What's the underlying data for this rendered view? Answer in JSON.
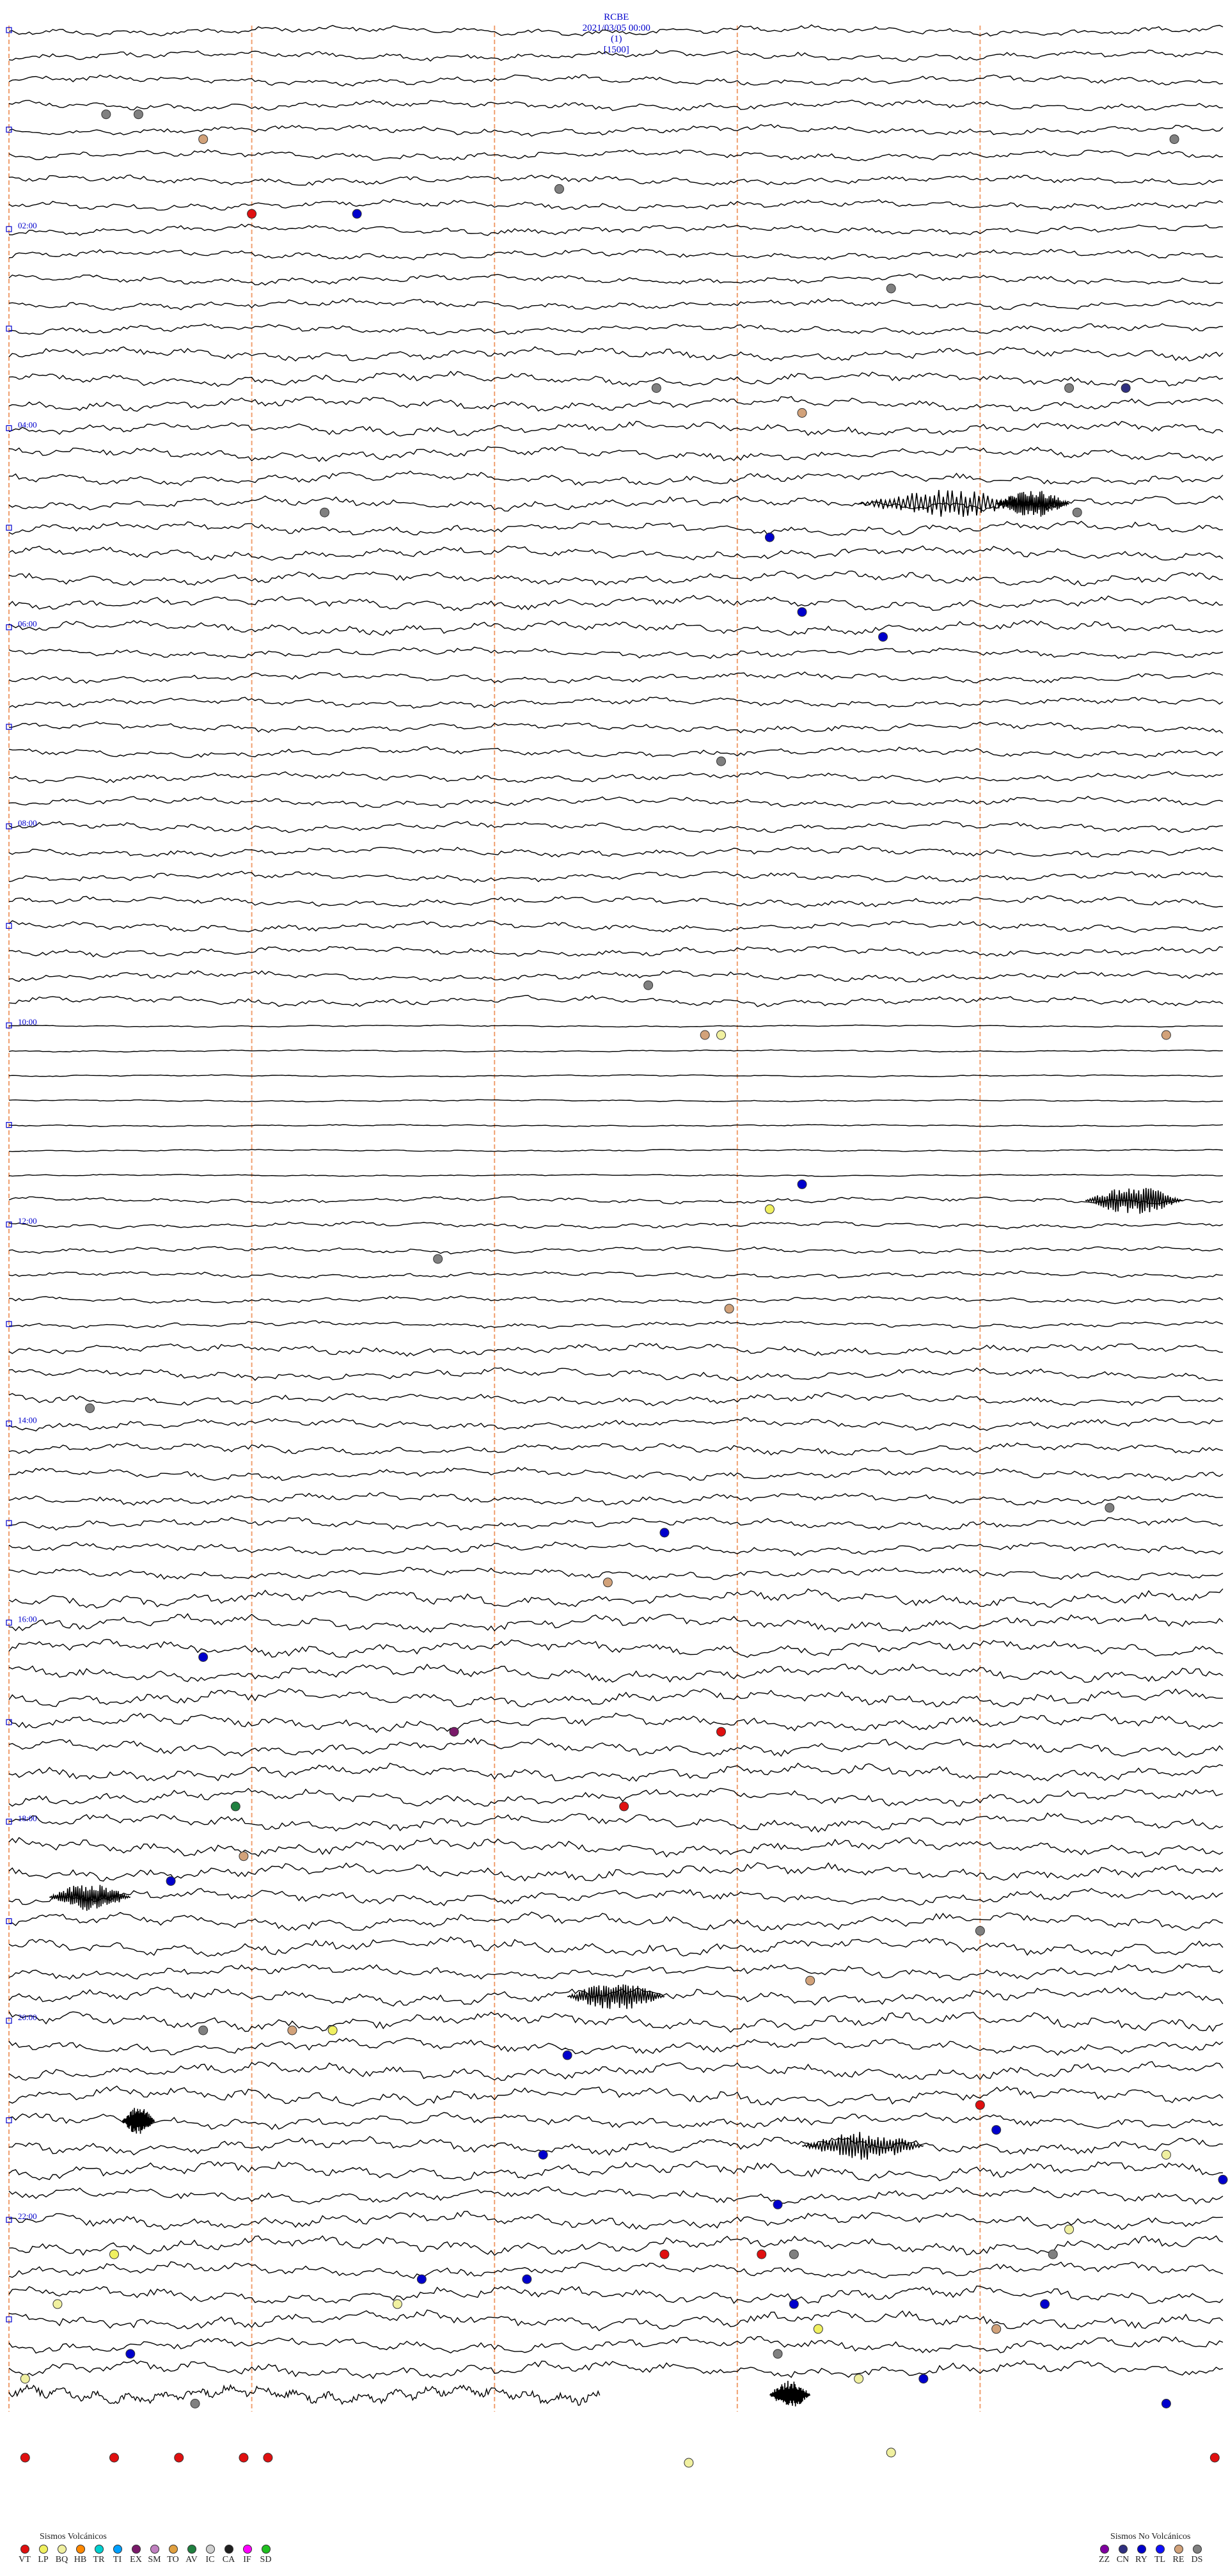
{
  "header": {
    "station": "RCBE",
    "datetime": "2021/03/05 00:00",
    "channel": "(1)",
    "scale": "[1500]"
  },
  "chart_data": {
    "type": "line",
    "description_kind": "helicorder",
    "trace_count": 96,
    "minutes_per_trace": 15,
    "hour_labels": [
      "02:00",
      "04:00",
      "06:00",
      "08:00",
      "10:00",
      "12:00",
      "14:00",
      "16:00",
      "18:00",
      "20:00",
      "22:00"
    ],
    "grid_x_minutes": [
      0,
      3,
      6,
      9,
      12
    ],
    "colors": {
      "trace": "#000000",
      "grid": "#f0a070",
      "labels": "#0000cc",
      "VT": "#e01010",
      "LP": "#f0f060",
      "BQ": "#f0f0a0",
      "HB": "#ff8800",
      "TR": "#00d0d0",
      "TI": "#00a0ff",
      "EX": "#7a1a6a",
      "SM": "#c080c0",
      "TO": "#e0a040",
      "AV": "#208040",
      "IC": "#d0d0d0",
      "CA": "#202020",
      "IF": "#ff00ff",
      "SD": "#20c020",
      "ZZ": "#8000a0",
      "CN": "#303080",
      "RY": "#0000cc",
      "TL": "#1010ff",
      "RE": "#d2a27a",
      "DS": "#808080"
    },
    "events": [
      {
        "trace": 3,
        "minute": 1.2,
        "type": "DS"
      },
      {
        "trace": 3,
        "minute": 1.6,
        "type": "DS"
      },
      {
        "trace": 4,
        "minute": 2.4,
        "type": "RE"
      },
      {
        "trace": 4,
        "minute": 14.4,
        "type": "DS"
      },
      {
        "trace": 6,
        "minute": 6.8,
        "type": "DS"
      },
      {
        "trace": 7,
        "minute": 3.0,
        "type": "VT"
      },
      {
        "trace": 7,
        "minute": 4.3,
        "type": "RY"
      },
      {
        "trace": 10,
        "minute": 10.9,
        "type": "DS"
      },
      {
        "trace": 14,
        "minute": 8.0,
        "type": "DS"
      },
      {
        "trace": 14,
        "minute": 13.1,
        "type": "DS"
      },
      {
        "trace": 14,
        "minute": 13.8,
        "type": "CN"
      },
      {
        "trace": 15,
        "minute": 9.8,
        "type": "RE"
      },
      {
        "trace": 19,
        "minute": 13.2,
        "type": "DS"
      },
      {
        "trace": 19,
        "minute": 3.9,
        "type": "DS"
      },
      {
        "trace": 20,
        "minute": 9.4,
        "type": "RY"
      },
      {
        "trace": 23,
        "minute": 9.8,
        "type": "RY"
      },
      {
        "trace": 24,
        "minute": 10.8,
        "type": "RY"
      },
      {
        "trace": 29,
        "minute": 8.8,
        "type": "DS"
      },
      {
        "trace": 38,
        "minute": 7.9,
        "type": "DS"
      },
      {
        "trace": 40,
        "minute": 8.8,
        "type": "BQ"
      },
      {
        "trace": 40,
        "minute": 8.6,
        "type": "RE"
      },
      {
        "trace": 40,
        "minute": 14.3,
        "type": "RE"
      },
      {
        "trace": 46,
        "minute": 9.8,
        "type": "RY"
      },
      {
        "trace": 47,
        "minute": 9.4,
        "type": "LP"
      },
      {
        "trace": 49,
        "minute": 5.3,
        "type": "DS"
      },
      {
        "trace": 51,
        "minute": 8.9,
        "type": "RE"
      },
      {
        "trace": 55,
        "minute": 1.0,
        "type": "DS"
      },
      {
        "trace": 59,
        "minute": 13.6,
        "type": "DS"
      },
      {
        "trace": 60,
        "minute": 8.1,
        "type": "RY"
      },
      {
        "trace": 62,
        "minute": 7.4,
        "type": "RE"
      },
      {
        "trace": 65,
        "minute": 2.4,
        "type": "RY"
      },
      {
        "trace": 68,
        "minute": 5.5,
        "type": "EX"
      },
      {
        "trace": 68,
        "minute": 8.8,
        "type": "VT"
      },
      {
        "trace": 71,
        "minute": 2.8,
        "type": "AV"
      },
      {
        "trace": 71,
        "minute": 7.6,
        "type": "VT"
      },
      {
        "trace": 73,
        "minute": 2.9,
        "type": "RE"
      },
      {
        "trace": 74,
        "minute": 2.0,
        "type": "RY"
      },
      {
        "trace": 76,
        "minute": 12.0,
        "type": "DS"
      },
      {
        "trace": 78,
        "minute": 9.9,
        "type": "RE"
      },
      {
        "trace": 80,
        "minute": 2.4,
        "type": "DS"
      },
      {
        "trace": 80,
        "minute": 3.5,
        "type": "RE"
      },
      {
        "trace": 80,
        "minute": 4.0,
        "type": "LP"
      },
      {
        "trace": 81,
        "minute": 6.9,
        "type": "RY"
      },
      {
        "trace": 83,
        "minute": 12.0,
        "type": "VT"
      },
      {
        "trace": 84,
        "minute": 12.2,
        "type": "RY"
      },
      {
        "trace": 85,
        "minute": 14.3,
        "type": "BQ"
      },
      {
        "trace": 85,
        "minute": 6.6,
        "type": "RY"
      },
      {
        "trace": 86,
        "minute": 15.0,
        "type": "RY"
      },
      {
        "trace": 87,
        "minute": 9.5,
        "type": "RY"
      },
      {
        "trace": 88,
        "minute": 13.1,
        "type": "BQ"
      },
      {
        "trace": 89,
        "minute": 1.3,
        "type": "LP"
      },
      {
        "trace": 89,
        "minute": 8.1,
        "type": "VT"
      },
      {
        "trace": 89,
        "minute": 9.3,
        "type": "VT"
      },
      {
        "trace": 89,
        "minute": 9.7,
        "type": "DS"
      },
      {
        "trace": 89,
        "minute": 12.9,
        "type": "DS"
      },
      {
        "trace": 90,
        "minute": 5.1,
        "type": "RY"
      },
      {
        "trace": 90,
        "minute": 6.4,
        "type": "RY"
      },
      {
        "trace": 91,
        "minute": 0.6,
        "type": "BQ"
      },
      {
        "trace": 91,
        "minute": 4.8,
        "type": "BQ"
      },
      {
        "trace": 91,
        "minute": 9.7,
        "type": "RY"
      },
      {
        "trace": 91,
        "minute": 12.8,
        "type": "RY"
      },
      {
        "trace": 92,
        "minute": 10.0,
        "type": "LP"
      },
      {
        "trace": 92,
        "minute": 12.2,
        "type": "RE"
      },
      {
        "trace": 93,
        "minute": 1.5,
        "type": "RY"
      },
      {
        "trace": 93,
        "minute": 9.5,
        "type": "DS"
      },
      {
        "trace": 94,
        "minute": 0.2,
        "type": "BQ"
      },
      {
        "trace": 94,
        "minute": 10.5,
        "type": "BQ"
      },
      {
        "trace": 94,
        "minute": 11.3,
        "type": "RY"
      },
      {
        "trace": 95,
        "minute": 2.3,
        "type": "DS"
      },
      {
        "trace": 95,
        "minute": 14.3,
        "type": "RY"
      }
    ],
    "bursts": [
      {
        "trace": 19,
        "minute": 10.5,
        "length": 2.2
      },
      {
        "trace": 19,
        "minute": 12.2,
        "length": 0.9
      },
      {
        "trace": 47,
        "minute": 13.3,
        "length": 1.2
      },
      {
        "trace": 79,
        "minute": 6.9,
        "length": 1.2
      },
      {
        "trace": 75,
        "minute": 0.5,
        "length": 1.0
      },
      {
        "trace": 84,
        "minute": 1.4,
        "length": 0.4
      },
      {
        "trace": 85,
        "minute": 9.8,
        "length": 1.5
      },
      {
        "trace": 95,
        "minute": 9.4,
        "length": 0.5
      }
    ]
  },
  "bottom_markers": {
    "red_minutes_row1": [
      0.2,
      1.3,
      2.1,
      2.9,
      3.2,
      14.9
    ],
    "yellow_minutes": [
      8.4,
      10.9
    ],
    "colors": [
      "VT",
      "BQ"
    ]
  },
  "legend_volcanic": {
    "title": "Sismos Volcánicos",
    "codes": [
      "VT",
      "LP",
      "BQ",
      "HB",
      "TR",
      "TI",
      "EX",
      "SM",
      "TO",
      "AV",
      "IC",
      "CA",
      "IF",
      "SD"
    ]
  },
  "legend_nonvolcanic": {
    "title": "Sismos No Volcánicos",
    "codes": [
      "ZZ",
      "CN",
      "RY",
      "TL",
      "RE",
      "DS"
    ]
  }
}
